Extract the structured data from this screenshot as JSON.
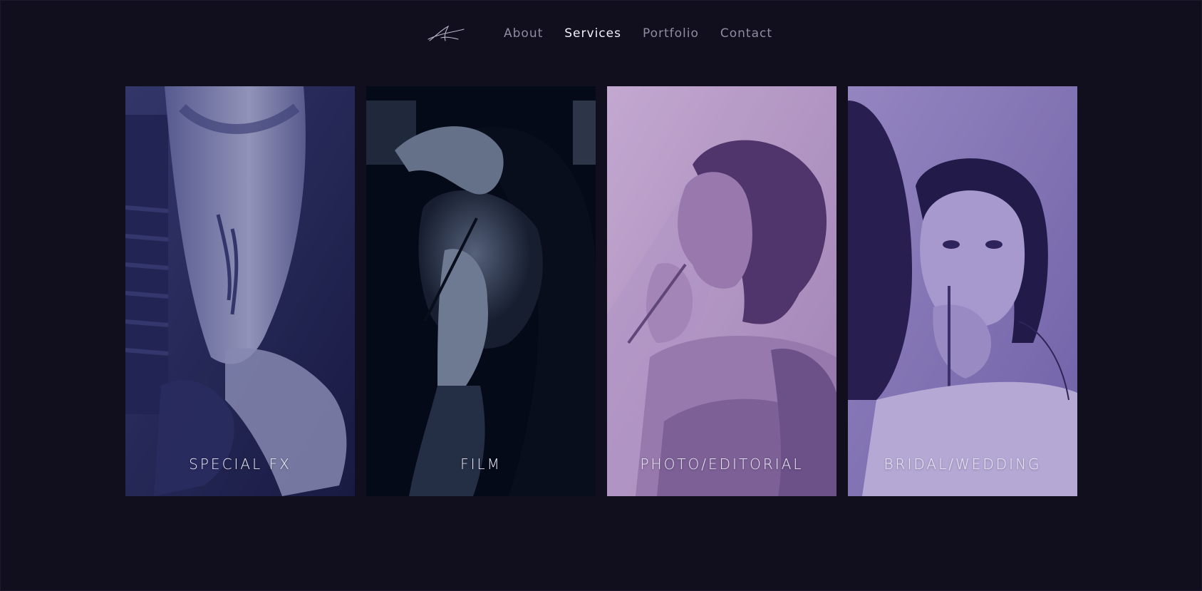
{
  "brand": {
    "logo_icon": "signature-logo-icon"
  },
  "nav": {
    "items": [
      {
        "label": "About",
        "active": false
      },
      {
        "label": "Services",
        "active": true
      },
      {
        "label": "Portfolio",
        "active": false
      },
      {
        "label": "Contact",
        "active": false
      }
    ]
  },
  "services": {
    "cards": [
      {
        "label": "SPECIAL FX",
        "image": "special-fx-photo",
        "tint": "#2a2d5e"
      },
      {
        "label": "FILM",
        "image": "film-photo",
        "tint": "#0c1226"
      },
      {
        "label": "PHOTO/EDITORIAL",
        "image": "photo-editorial-photo",
        "tint": "#b89cc8"
      },
      {
        "label": "BRIDAL/WEDDING",
        "image": "bridal-wedding-photo",
        "tint": "#8a78b8"
      }
    ]
  },
  "colors": {
    "background": "#110f1e",
    "nav_active": "#f1eff8",
    "nav_inactive": "#8f8ba0"
  }
}
